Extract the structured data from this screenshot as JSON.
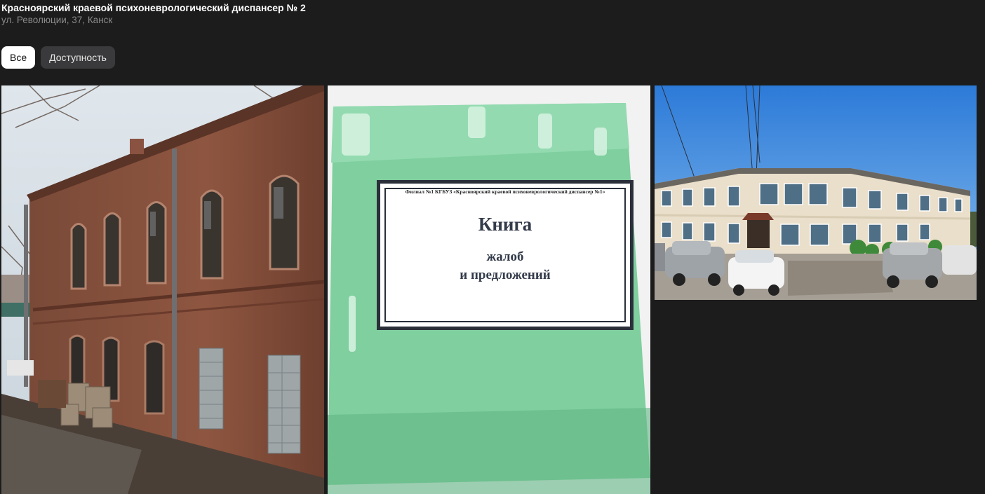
{
  "header": {
    "title": "Красноярский краевой психоневрологический диспансер № 2",
    "address": "ул. Революции, 37, Канск"
  },
  "tabs": [
    {
      "label": "Все",
      "active": true
    },
    {
      "label": "Доступность",
      "active": false
    }
  ],
  "photos": [
    {
      "name": "brick-building-photo"
    },
    {
      "name": "complaint-book-photo",
      "book": {
        "header": "Филиал №1 КГБУЗ «Красноярский краевой психоневрологический диспансер №1»",
        "title": "Книга",
        "line1": "жалоб",
        "line2": "и предложений"
      }
    },
    {
      "name": "building-street-photo"
    }
  ],
  "colors": {
    "background": "#1c1c1c",
    "tab_active_bg": "#ffffff",
    "tab_inactive_bg": "#3a3a3c",
    "address_text": "#8a8a8a"
  }
}
